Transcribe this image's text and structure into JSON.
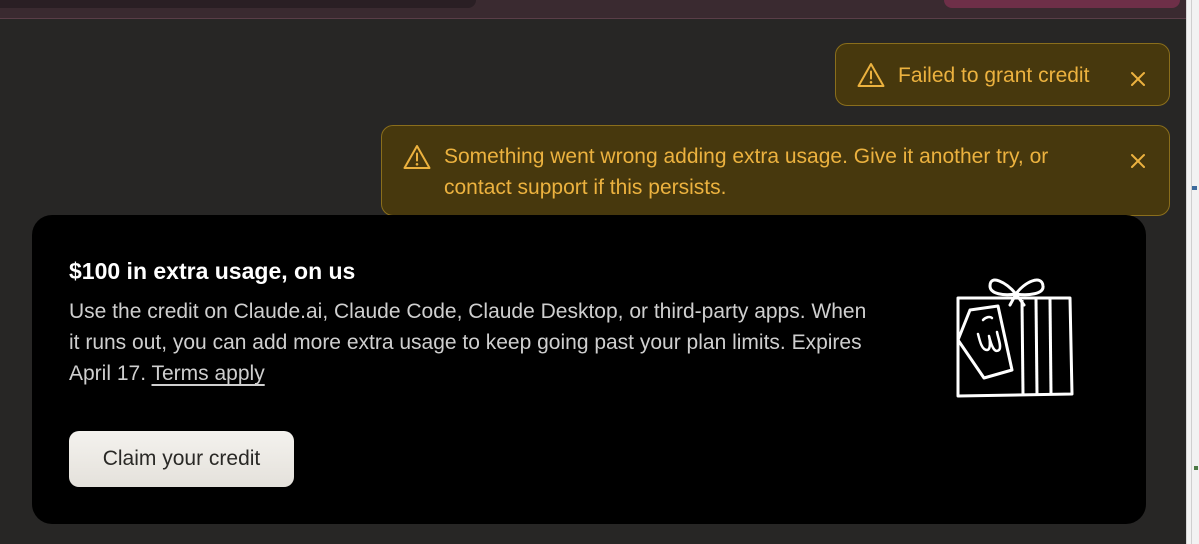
{
  "toasts": [
    {
      "icon": "warning-icon",
      "message": "Failed to grant credit",
      "close_icon": "close-icon"
    },
    {
      "icon": "warning-icon",
      "message": "Something went wrong adding extra usage. Give it another try, or\ncontact support if this persists.",
      "close_icon": "close-icon"
    }
  ],
  "promo": {
    "title": "$100 in extra usage, on us",
    "body": "Use the credit on Claude.ai, Claude Code, Claude Desktop, or third-party apps. When it runs out, you can add more extra usage to keep going past your plan limits. Expires April 17. ",
    "terms_link": "Terms apply",
    "button_label": "Claim your credit",
    "illustration": "gift-box-icon"
  },
  "colors": {
    "background": "#272625",
    "toast_bg": "#47380d",
    "toast_border": "#8a6e1c",
    "toast_text": "#ecb23f",
    "card_bg": "#000000",
    "button_bg": "#f0eeea"
  }
}
